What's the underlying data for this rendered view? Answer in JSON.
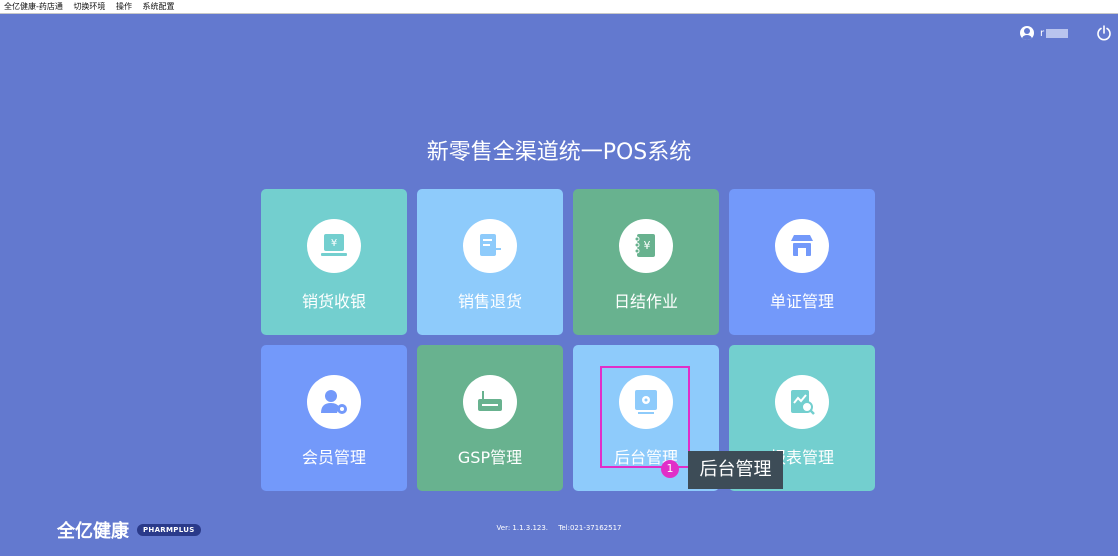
{
  "menu": {
    "app_title": "全亿健康-药店通",
    "switch_env": "切换环境",
    "operate": "操作",
    "system_config": "系统配置"
  },
  "header": {
    "username": "r",
    "power_icon": "power-icon"
  },
  "main": {
    "title": "新零售全渠道统一POS系统",
    "tiles": [
      {
        "label": "销货收银",
        "icon": "cashier-icon",
        "color": "#73cfcf"
      },
      {
        "label": "销售退货",
        "icon": "return-icon",
        "color": "#8ecbfb"
      },
      {
        "label": "日结作业",
        "icon": "daily-settle-icon",
        "color": "#68b28f"
      },
      {
        "label": "单证管理",
        "icon": "store-icon",
        "color": "#7399fa"
      },
      {
        "label": "会员管理",
        "icon": "member-icon",
        "color": "#7399fa"
      },
      {
        "label": "GSP管理",
        "icon": "gsp-icon",
        "color": "#68b28f"
      },
      {
        "label": "后台管理",
        "icon": "backend-icon",
        "color": "#8ecbfb"
      },
      {
        "label": "报表管理",
        "icon": "report-icon",
        "color": "#73cfcf"
      }
    ]
  },
  "annotation": {
    "marker_number": "1",
    "tooltip": "后台管理"
  },
  "footer": {
    "brand": "全亿健康",
    "badge": "PHARMPLUS",
    "version": "Ver: 1.1.3.123.",
    "tel": "Tel:021-37162517"
  },
  "colors": {
    "background": "#6379cf",
    "highlight": "#e12ec8"
  }
}
